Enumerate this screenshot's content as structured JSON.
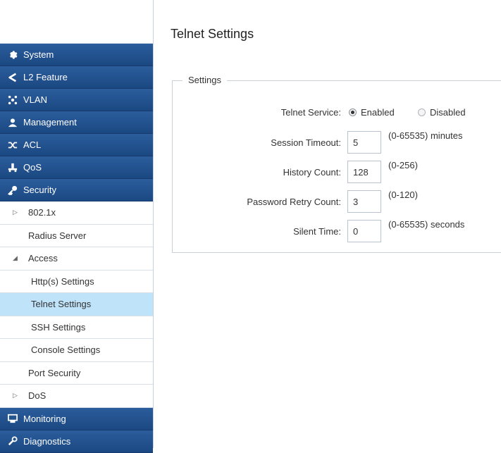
{
  "sidebar": {
    "main_items": [
      {
        "label": "System",
        "icon": "gear-icon"
      },
      {
        "label": "L2 Feature",
        "icon": "share-icon"
      },
      {
        "label": "VLAN",
        "icon": "network-icon"
      },
      {
        "label": "Management",
        "icon": "user-icon"
      },
      {
        "label": "ACL",
        "icon": "shuffle-icon"
      },
      {
        "label": "QoS",
        "icon": "qos-icon"
      },
      {
        "label": "Security",
        "icon": "key-icon"
      }
    ],
    "security_items": [
      {
        "label": "802.1x",
        "arrow": "▷"
      },
      {
        "label": "Radius Server",
        "arrow": ""
      },
      {
        "label": "Access",
        "arrow": "◢"
      },
      {
        "label": "Http(s) Settings"
      },
      {
        "label": "Telnet Settings"
      },
      {
        "label": "SSH Settings"
      },
      {
        "label": "Console Settings"
      },
      {
        "label": "Port Security",
        "arrow": ""
      },
      {
        "label": "DoS",
        "arrow": "▷"
      }
    ],
    "bottom_items": [
      {
        "label": "Monitoring",
        "icon": "monitor-icon"
      },
      {
        "label": "Diagnostics",
        "icon": "wrench-icon"
      }
    ],
    "active_item": "Telnet Settings"
  },
  "page": {
    "title": "Telnet Settings",
    "legend": "Settings"
  },
  "form": {
    "telnet_service_label": "Telnet Service:",
    "enabled_label": "Enabled",
    "disabled_label": "Disabled",
    "telnet_service_value": "Enabled",
    "session_timeout_label": "Session Timeout:",
    "session_timeout_value": "5",
    "session_timeout_hint": "(0-65535) minutes",
    "history_count_label": "History Count:",
    "history_count_value": "128",
    "history_count_hint": "(0-256)",
    "password_retry_label": "Password Retry Count:",
    "password_retry_value": "3",
    "password_retry_hint": "(0-120)",
    "silent_time_label": "Silent Time:",
    "silent_time_value": "0",
    "silent_time_hint": "(0-65535) seconds"
  },
  "colors": {
    "nav_blue": "#1f4f8c",
    "active_bg": "#bfe3f9"
  }
}
